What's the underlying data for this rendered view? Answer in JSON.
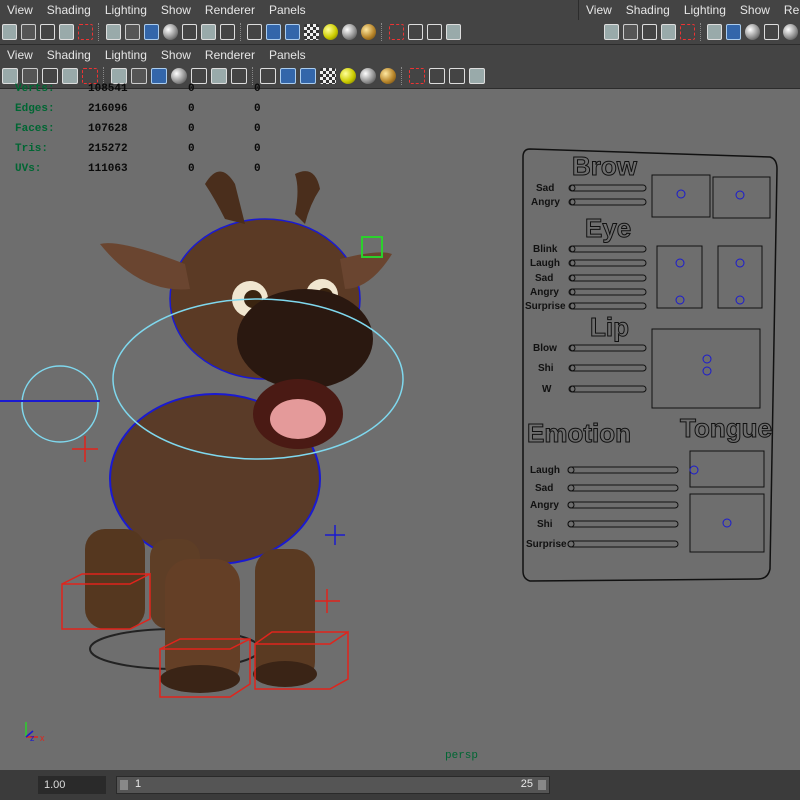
{
  "menus": {
    "top_left": [
      "View",
      "Shading",
      "Lighting",
      "Show",
      "Renderer",
      "Panels"
    ],
    "top_right": [
      "View",
      "Shading",
      "Lighting",
      "Show",
      "Rende"
    ],
    "second": [
      "View",
      "Shading",
      "Lighting",
      "Show",
      "Renderer",
      "Panels"
    ]
  },
  "hud": {
    "rows": [
      {
        "label": "Verts:",
        "v1": "108541",
        "v2": "0",
        "v3": "0"
      },
      {
        "label": "Edges:",
        "v1": "216096",
        "v2": "0",
        "v3": "0"
      },
      {
        "label": "Faces:",
        "v1": "107628",
        "v2": "0",
        "v3": "0"
      },
      {
        "label": "Tris:",
        "v1": "215272",
        "v2": "0",
        "v3": "0"
      },
      {
        "label": "UVs:",
        "v1": "111063",
        "v2": "0",
        "v3": "0"
      }
    ]
  },
  "face_panel": {
    "brow_title": "Brow",
    "brow_sliders": [
      "Sad",
      "Angry"
    ],
    "eye_title": "Eye",
    "eye_sliders": [
      "Blink",
      "Laugh",
      "Sad",
      "Angry",
      "Surprise"
    ],
    "lip_title": "Lip",
    "lip_sliders": [
      "Blow",
      "Shi",
      "W"
    ],
    "emotion_title": "Emotion",
    "tongue_title": "Tongue",
    "emotion_sliders": [
      "Laugh",
      "Sad",
      "Angry",
      "Shi",
      "Surprise"
    ]
  },
  "viewport": {
    "camera_label": "persp",
    "axis_x": "x",
    "axis_z": "z"
  },
  "timeline": {
    "playback_speed": "1.00",
    "start_frame": "1",
    "end_frame": "25"
  },
  "colors": {
    "panel_bg": "#444444",
    "viewport_bg": "#6e6e6e",
    "hud_label": "#006633",
    "rig_red": "#e0241c",
    "rig_blue": "#1a1ad0",
    "rig_cyan": "#7fd8ee"
  }
}
